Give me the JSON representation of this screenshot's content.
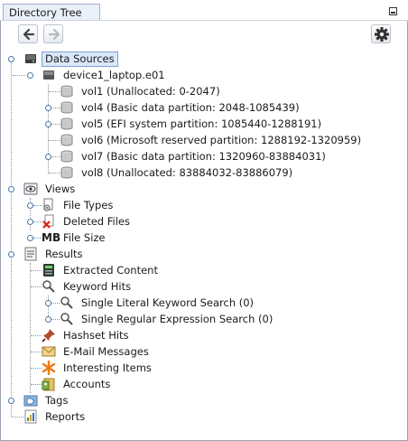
{
  "window": {
    "title": "Directory Tree"
  },
  "toolbar": {
    "back": "back-arrow-icon",
    "forward": "forward-arrow-icon",
    "settings": "gear-icon"
  },
  "tree": {
    "data_sources": "Data Sources",
    "device": "device1_laptop.e01",
    "volumes": [
      "vol1 (Unallocated: 0-2047)",
      "vol4 (Basic data partition: 2048-1085439)",
      "vol5 (EFI system partition: 1085440-1288191)",
      "vol6 (Microsoft reserved partition: 1288192-1320959)",
      "vol7 (Basic data partition: 1320960-83884031)",
      "vol8 (Unallocated: 83884032-83886079)"
    ],
    "views": "Views",
    "file_types": "File Types",
    "deleted_files": "Deleted Files",
    "file_size": "File Size",
    "file_size_badge": "MB",
    "results": "Results",
    "extracted_content": "Extracted Content",
    "keyword_hits": "Keyword Hits",
    "single_literal": "Single Literal Keyword Search (0)",
    "single_regex": "Single Regular Expression Search (0)",
    "hashset_hits": "Hashset Hits",
    "email_messages": "E-Mail Messages",
    "interesting_items": "Interesting Items",
    "accounts": "Accounts",
    "tags": "Tags",
    "reports": "Reports"
  },
  "colors": {
    "selection": "#d9e8f8",
    "selection_border": "#7da2ce",
    "tree_line": "#8896a8",
    "expander": "#4b78a8"
  }
}
